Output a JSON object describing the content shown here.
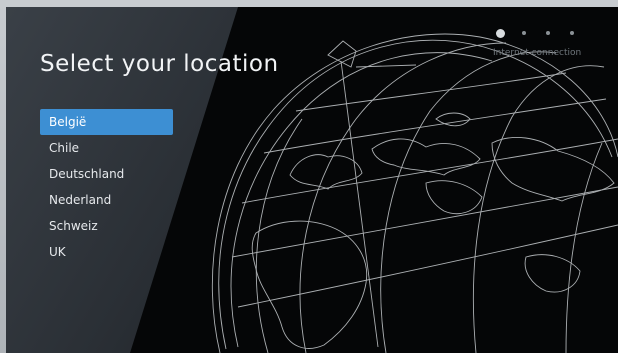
{
  "page": {
    "title": "Select your location"
  },
  "locations": [
    {
      "label": "België",
      "selected": true
    },
    {
      "label": "Chile",
      "selected": false
    },
    {
      "label": "Deutschland",
      "selected": false
    },
    {
      "label": "Nederland",
      "selected": false
    },
    {
      "label": "Schweiz",
      "selected": false
    },
    {
      "label": "UK",
      "selected": false
    }
  ],
  "progress": {
    "current_step": 1,
    "total_steps": 4,
    "next_step_label": "Internet connection"
  },
  "colors": {
    "accent": "#3d8fd3",
    "background": "#050607",
    "globe_lines": "#c9cdd0"
  },
  "icons": {
    "background_graphic": "globe-icon"
  }
}
